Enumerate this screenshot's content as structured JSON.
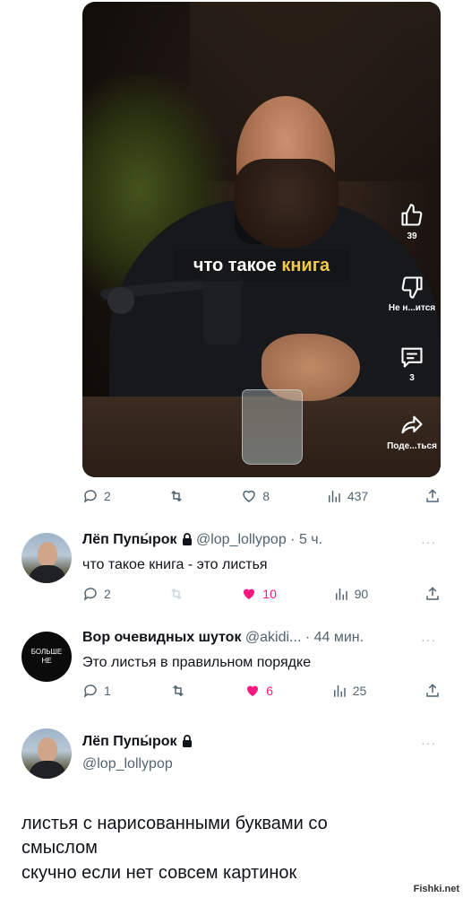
{
  "video": {
    "caption_plain": "что такое ",
    "caption_highlight": "книга",
    "side_actions": [
      {
        "icon": "thumbs-up-icon",
        "label": "39"
      },
      {
        "icon": "thumbs-down-icon",
        "label": "Не н...ится"
      },
      {
        "icon": "comment-icon",
        "label": "3"
      },
      {
        "icon": "share-icon",
        "label": "Поде...ться"
      }
    ]
  },
  "post_actions": {
    "replies": "2",
    "likes": "8",
    "views": "437"
  },
  "reply1": {
    "name": "Лёп Пупы́рок",
    "handle": "@lop_lollypop",
    "time": "· 5 ч.",
    "more": "···",
    "text": "что такое книга - это листья",
    "replies": "2",
    "likes": "10",
    "views": "90"
  },
  "reply2": {
    "avatar_text": "БОЛЬШЕ НЕ",
    "name": "Вор очевидных шуток",
    "handle": "@akidi...",
    "time": "· 44 мин.",
    "more": "···",
    "text": "Это листья в правильном порядке",
    "replies": "1",
    "likes": "6",
    "views": "25"
  },
  "profile": {
    "name": "Лёп Пупы́рок",
    "handle": "@lop_lollypop",
    "more": "···"
  },
  "main_text": {
    "line1": "листья с нарисованными буквами со",
    "line2": "смыслом",
    "line3": "скучно если нет совсем картинок"
  },
  "watermark": "Fishki.net",
  "colors": {
    "like_active": "#f91880",
    "icon_gray": "#536471",
    "caption_highlight": "#f3c94a"
  }
}
